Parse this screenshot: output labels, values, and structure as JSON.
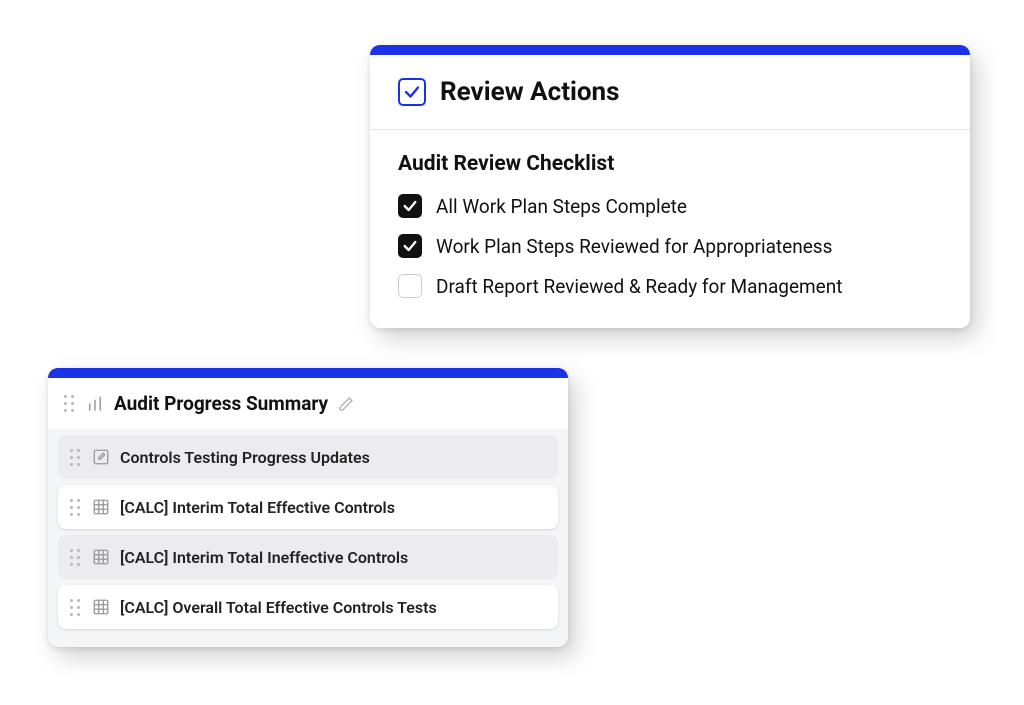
{
  "colors": {
    "accent": "#1a33e6"
  },
  "review": {
    "title": "Review Actions",
    "checklist_title": "Audit Review Checklist",
    "items": [
      {
        "label": "All Work Plan Steps Complete",
        "checked": true
      },
      {
        "label": "Work Plan Steps Reviewed for Appropriateness",
        "checked": true
      },
      {
        "label": "Draft Report Reviewed & Ready for Management",
        "checked": false
      }
    ]
  },
  "progress": {
    "title": "Audit Progress Summary",
    "rows": [
      {
        "label": "Controls Testing Progress Updates",
        "icon": "compose",
        "raised": false
      },
      {
        "label": "[CALC] Interim Total Effective Controls",
        "icon": "table",
        "raised": true
      },
      {
        "label": "[CALC] Interim Total Ineffective Controls",
        "icon": "table",
        "raised": false
      },
      {
        "label": "[CALC] Overall Total Effective Controls Tests",
        "icon": "table",
        "raised": true
      }
    ]
  }
}
